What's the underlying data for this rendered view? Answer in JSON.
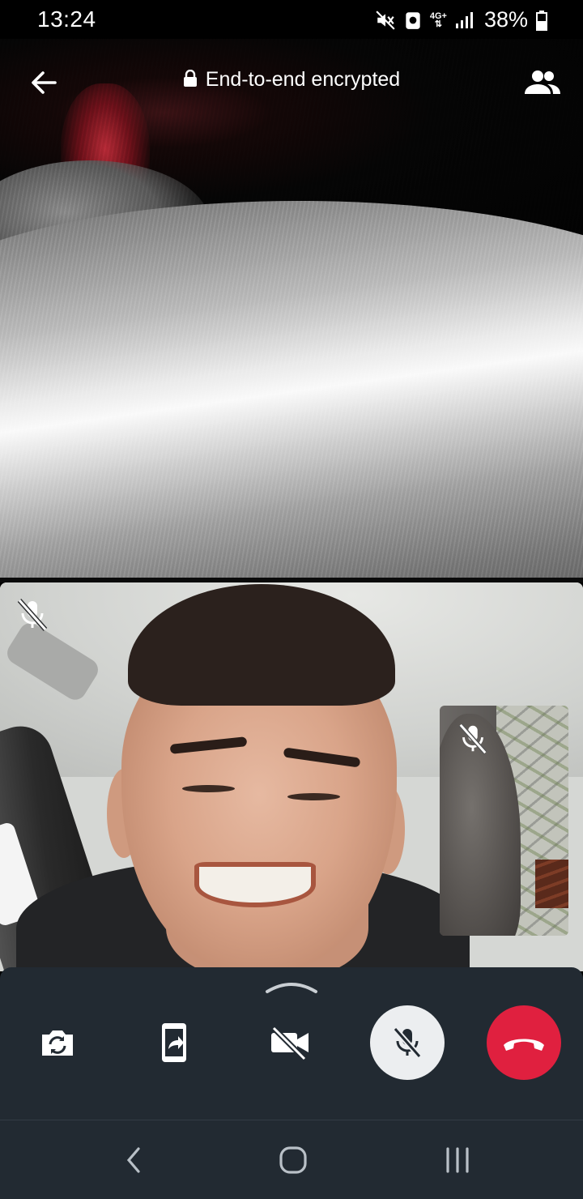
{
  "status_bar": {
    "time": "13:24",
    "network": "4G+",
    "battery": "38%"
  },
  "header": {
    "title": "End-to-end encrypted",
    "icons": [
      "back-arrow-icon",
      "lock-icon",
      "participants-icon"
    ]
  },
  "video_tiles": {
    "remote_muted_icon": "mic-off-icon",
    "self_view_muted_icon": "mic-off-icon"
  },
  "call_controls": {
    "buttons": [
      {
        "name": "flip-camera",
        "icon": "camera-flip-icon"
      },
      {
        "name": "share-screen",
        "icon": "screen-share-icon"
      },
      {
        "name": "video-toggle",
        "icon": "video-off-icon",
        "state": "off"
      },
      {
        "name": "mute-toggle",
        "icon": "mic-off-icon",
        "state": "muted"
      },
      {
        "name": "end-call",
        "icon": "hang-up-icon"
      }
    ],
    "colors": {
      "panel": "#222a32",
      "end_call": "#e0203f",
      "active": "#eceef0"
    }
  },
  "nav_bar": {
    "icons": [
      "back-nav-icon",
      "home-nav-icon",
      "recents-nav-icon"
    ]
  }
}
